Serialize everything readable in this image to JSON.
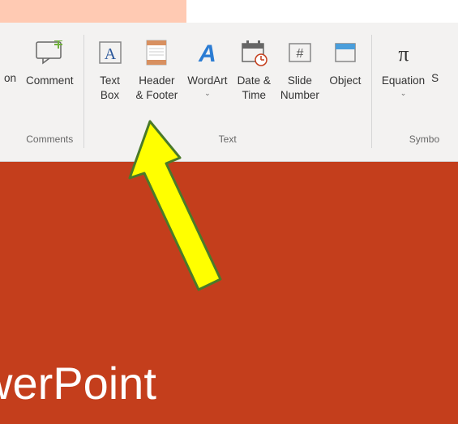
{
  "ribbon": {
    "groups": {
      "comments": {
        "label": "Comments",
        "items": {
          "comment": {
            "label": "Comment"
          }
        }
      },
      "text": {
        "label": "Text",
        "items": {
          "textbox": {
            "label": "Text\nBox"
          },
          "headerfooter": {
            "label": "Header\n& Footer"
          },
          "wordart": {
            "label": "WordArt",
            "chevron": "⌄"
          },
          "datetime": {
            "label": "Date &\nTime"
          },
          "slidenumber": {
            "label": "Slide\nNumber"
          },
          "object": {
            "label": "Object"
          }
        }
      },
      "symbols": {
        "label": "Symbo",
        "items": {
          "equation": {
            "label": "Equation",
            "chevron": "⌄"
          },
          "symbol_partial": {
            "label": "S"
          }
        }
      }
    },
    "partial_left_label": "on"
  },
  "slide": {
    "title_visible": "werPoint"
  },
  "colors": {
    "slide_bg": "#c43e1c",
    "ribbon_bg": "#f3f2f1",
    "arrow_fill": "#ffff00",
    "arrow_stroke": "#4a7a2a"
  }
}
